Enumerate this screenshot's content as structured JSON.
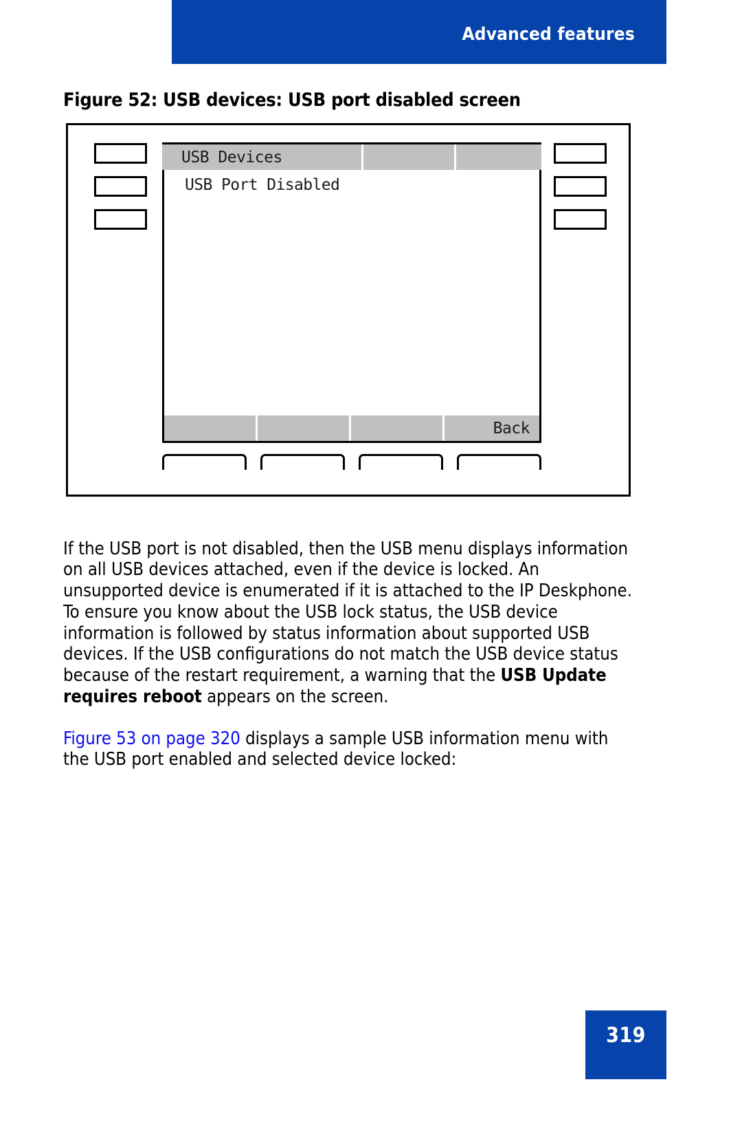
{
  "header": {
    "title": "Advanced features",
    "bar_color": "#0644ab"
  },
  "figure": {
    "caption": "Figure 52: USB devices: USB port disabled screen",
    "screen": {
      "tabs": [
        {
          "label": "USB Devices"
        },
        {
          "label": ""
        },
        {
          "label": ""
        }
      ],
      "content_line": "USB Port Disabled",
      "softkeys": [
        {
          "label": ""
        },
        {
          "label": ""
        },
        {
          "label": ""
        },
        {
          "label": "Back"
        }
      ]
    },
    "side_keys": {
      "left": [
        "",
        "",
        ""
      ],
      "right": [
        "",
        "",
        ""
      ]
    },
    "bottom_keys": [
      "",
      "",
      "",
      ""
    ]
  },
  "body": {
    "paragraph_1_part_1": "If the USB port is not disabled, then the USB menu displays information on all USB devices attached, even if the device is locked. An unsupported device is enumerated if it is attached to the IP Deskphone. To ensure you know about the USB lock status, the USB device information is followed by status information about supported USB devices. If the USB configurations do not match the USB device status because of the restart requirement, a warning that the ",
    "paragraph_1_bold": "USB Update requires reboot",
    "paragraph_1_part_2": " appears on the screen.",
    "paragraph_2_link": "Figure 53 on page 320",
    "paragraph_2_rest": " displays a sample USB information menu with the USB port enabled and selected device locked:"
  },
  "footer": {
    "page_number": "319",
    "box_color": "#0644ab"
  }
}
